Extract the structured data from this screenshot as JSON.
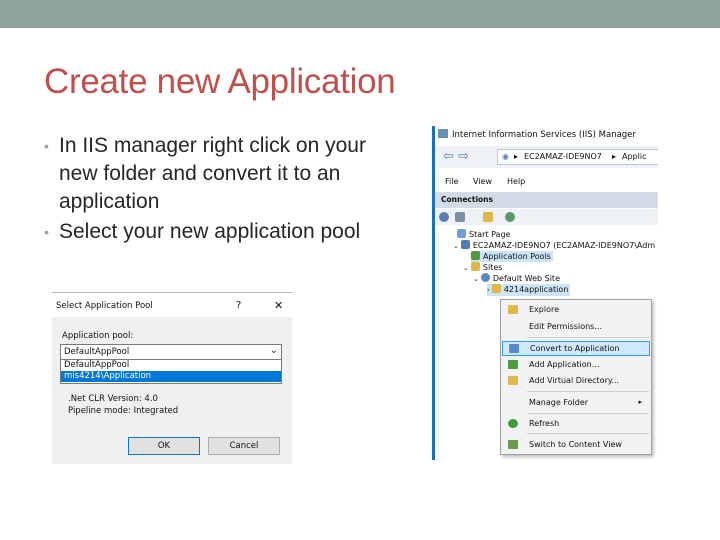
{
  "slide": {
    "title": "Create new Application",
    "bullets": [
      "In IIS manager right click on your new folder and convert it to an application",
      "Select your new application pool"
    ],
    "bullet_glyph": "•"
  },
  "dialog": {
    "title": "Select Application Pool",
    "help": "?",
    "close": "✕",
    "pool_label": "Application pool:",
    "selected_value": "DefaultAppPool",
    "options": [
      "DefaultAppPool",
      "mis4214\\Application"
    ],
    "clr_version": ".Net CLR Version: 4.0",
    "pipeline_mode": "Pipeline mode: Integrated",
    "ok_label": "OK",
    "cancel_label": "Cancel"
  },
  "iis": {
    "window_title": "Internet Information Services (IIS) Manager",
    "address_server": "EC2AMAZ-IDE9NO7",
    "address_next": "Applic",
    "address_sep": "▸",
    "menu": [
      "File",
      "View",
      "Help"
    ],
    "connections_header": "Connections",
    "tree": {
      "start_page": "Start Page",
      "server": "EC2AMAZ-IDE9NO7 (EC2AMAZ-IDE9NO7\\Adm",
      "app_pools": "Application Pools",
      "sites": "Sites",
      "default_site": "Default Web Site",
      "folder": "4214application"
    }
  },
  "context_menu": {
    "items": [
      {
        "label": "Explore",
        "icon": "explore-icon",
        "color": "#e0b84a"
      },
      {
        "label": "Edit Permissions...",
        "icon": "",
        "color": ""
      },
      {
        "label": "Convert to Application",
        "icon": "convert-icon",
        "color": "#5a88c8"
      },
      {
        "label": "Add Application...",
        "icon": "add-application-icon",
        "color": "#4f9a3e"
      },
      {
        "label": "Add Virtual Directory...",
        "icon": "add-virtual-directory-icon",
        "color": "#e0b84a"
      },
      {
        "label": "Manage Folder",
        "icon": "",
        "color": ""
      },
      {
        "label": "Refresh",
        "icon": "refresh-icon",
        "color": "#3c9a3c"
      },
      {
        "label": "Switch to Content View",
        "icon": "content-view-icon",
        "color": "#6a9a4a"
      }
    ],
    "submenu_arrow": "▸"
  },
  "colors": {
    "title": "#c0504d",
    "accent_band": "#8da49a",
    "selection": "#0078d7",
    "menu_highlight": "#cde8ff"
  }
}
